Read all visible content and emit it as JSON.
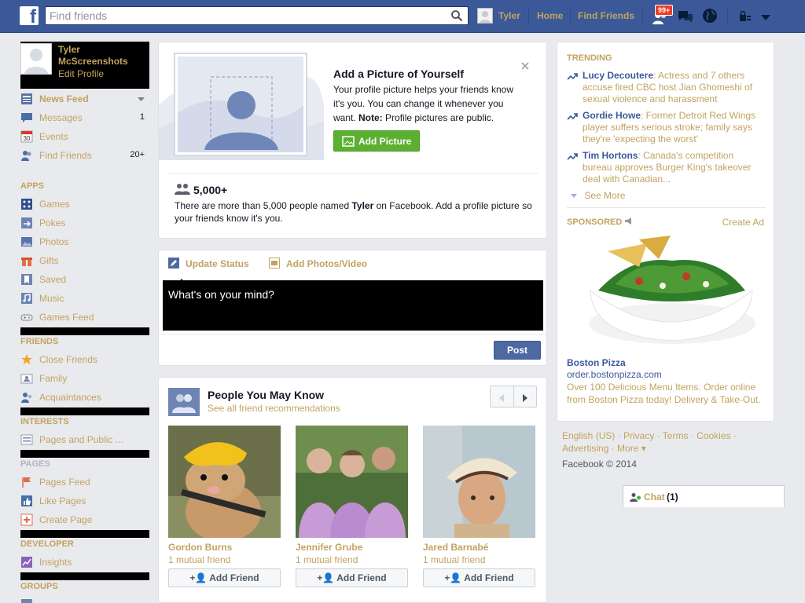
{
  "topbar": {
    "logo": "f",
    "search_placeholder": "Find friends",
    "user": "Tyler",
    "home": "Home",
    "find_friends": "Find Friends",
    "notif_badge": "99+"
  },
  "profile": {
    "name": "Tyler McScreenshots",
    "edit": "Edit Profile"
  },
  "nav": {
    "favorites": [
      {
        "label": "News Feed",
        "count": ""
      },
      {
        "label": "Messages",
        "count": "1"
      },
      {
        "label": "Events",
        "count": ""
      },
      {
        "label": "Find Friends",
        "count": "20+"
      }
    ],
    "apps_header": "APPS",
    "apps": [
      {
        "label": "Games"
      },
      {
        "label": "Pokes"
      },
      {
        "label": "Photos"
      },
      {
        "label": "Gifts"
      },
      {
        "label": "Saved"
      },
      {
        "label": "Music"
      },
      {
        "label": "Games Feed"
      }
    ],
    "friends_header": "FRIENDS",
    "friends": [
      {
        "label": "Close Friends"
      },
      {
        "label": "Family"
      },
      {
        "label": "Acquaintances"
      }
    ],
    "interests_header": "INTERESTS",
    "interests": [
      {
        "label": "Pages and Public ..."
      }
    ],
    "pages_header": "PAGES",
    "pages": [
      {
        "label": "Pages Feed"
      },
      {
        "label": "Like Pages"
      },
      {
        "label": "Create Page"
      }
    ],
    "developer_header": "DEVELOPER",
    "developer": [
      {
        "label": "Insights"
      }
    ],
    "groups_header": "GROUPS"
  },
  "pic_card": {
    "title": "Add a Picture of Yourself",
    "desc_1": "Your profile picture helps your friends know it's you. You can change it whenever you want. ",
    "note_label": "Note:",
    "desc_2": " Profile pictures are public.",
    "add_button": "Add Picture",
    "count": "5,000+",
    "names_1": "There are more than 5,000 people named ",
    "names_bold": "Tyler",
    "names_2": " on Facebook. Add a profile picture so your friends know it's you."
  },
  "status": {
    "tab_update": "Update Status",
    "tab_photos": "Add Photos/Video",
    "placeholder": "What's on your mind?",
    "post": "Post"
  },
  "pymk": {
    "title": "People You May Know",
    "see_all": "See all friend recommendations",
    "add_friend": "Add Friend",
    "people": [
      {
        "name": "Gordon Burns",
        "mutual": "1 mutual friend"
      },
      {
        "name": "Jennifer Grube",
        "mutual": "1 mutual friend"
      },
      {
        "name": "Jared Barnabé",
        "mutual": "1 mutual friend"
      }
    ]
  },
  "trending": {
    "header": "TRENDING",
    "items": [
      {
        "topic": "Lucy Decoutere",
        "text": ": Actress and 7 others accuse fired CBC host Jian Ghomeshi of sexual violence and harassment"
      },
      {
        "topic": "Gordie Howe",
        "text": ": Former Detroit Red Wings player suffers serious stroke; family says they're 'expecting the worst'"
      },
      {
        "topic": "Tim Hortons",
        "text": ": Canada's competition bureau approves Burger King's takeover deal with Canadian..."
      }
    ],
    "see_more": "See More"
  },
  "sponsored": {
    "header": "SPONSORED",
    "create_ad": "Create Ad",
    "title": "Boston Pizza",
    "url": "order.bostonpizza.com",
    "body": "Over 100 Delicious Menu Items. Order online from Boston Pizza today! Delivery & Take-Out."
  },
  "footer": {
    "line1": "English (US) · Privacy · Terms · Cookies ·",
    "line2": "Advertising · More ▾",
    "copyright": "Facebook © 2014"
  },
  "chat": {
    "label": "Chat",
    "count": "(1)"
  }
}
